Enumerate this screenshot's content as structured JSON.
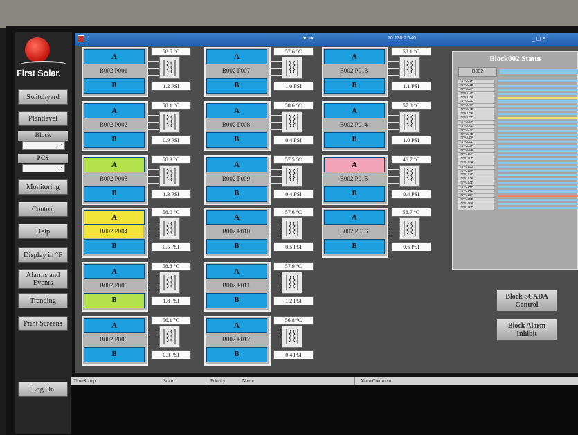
{
  "app": {
    "brand": "First Solar.",
    "window_ip": "10.130.2.140",
    "window_controls": "_ ◻ ×"
  },
  "sidebar": {
    "items": [
      {
        "label": "Switchyard"
      },
      {
        "label": "Plantlevel"
      },
      {
        "label": "Block"
      },
      {
        "label": "PCS"
      },
      {
        "label": "Monitoring"
      },
      {
        "label": "Control"
      },
      {
        "label": "Help"
      },
      {
        "label": "Display in °F"
      },
      {
        "label": "Alarms and Events"
      },
      {
        "label": "Trending"
      },
      {
        "label": "Print Screens"
      }
    ],
    "logon": "Log On"
  },
  "inverters": [
    {
      "name": "B002 P001",
      "a": "A",
      "b": "B",
      "temp": "58.5 °C",
      "psi": "1.2 PSI"
    },
    {
      "name": "B002 P002",
      "a": "A",
      "b": "B",
      "temp": "58.1 °C",
      "psi": "0.9 PSI"
    },
    {
      "name": "B002 P003",
      "a": "A",
      "b": "B",
      "temp": "58.3 °C",
      "psi": "1.3 PSI"
    },
    {
      "name": "B002 P004",
      "a": "A",
      "b": "B",
      "temp": "58.0 °C",
      "psi": "0.5 PSI"
    },
    {
      "name": "B002 P005",
      "a": "A",
      "b": "B",
      "temp": "58.8 °C",
      "psi": "1.8 PSI"
    },
    {
      "name": "B002 P006",
      "a": "A",
      "b": "B",
      "temp": "56.1 °C",
      "psi": "0.3 PSI"
    },
    {
      "name": "B002 P007",
      "a": "A",
      "b": "B",
      "temp": "57.6 °C",
      "psi": "1.0 PSI"
    },
    {
      "name": "B002 P008",
      "a": "A",
      "b": "B",
      "temp": "58.6 °C",
      "psi": "0.4 PSI"
    },
    {
      "name": "B002 P009",
      "a": "A",
      "b": "B",
      "temp": "57.5 °C",
      "psi": "0.4 PSI"
    },
    {
      "name": "B002 P010",
      "a": "A",
      "b": "B",
      "temp": "57.6 °C",
      "psi": "0.5 PSI"
    },
    {
      "name": "B002 P011",
      "a": "A",
      "b": "B",
      "temp": "57.9 °C",
      "psi": "1.2 PSI"
    },
    {
      "name": "B002 P012",
      "a": "A",
      "b": "B",
      "temp": "56.8 °C",
      "psi": "0.4 PSI"
    },
    {
      "name": "B002 P013",
      "a": "A",
      "b": "B",
      "temp": "58.1 °C",
      "psi": "1.1 PSI"
    },
    {
      "name": "B002 P014",
      "a": "A",
      "b": "B",
      "temp": "57.8 °C",
      "psi": "1.0 PSI"
    },
    {
      "name": "B002 P015",
      "a": "A",
      "b": "B",
      "temp": "46.7 °C",
      "psi": "0.4 PSI"
    },
    {
      "name": "B002 P016",
      "a": "A",
      "b": "B",
      "temp": "58.7 °C",
      "psi": "0.6 PSI"
    }
  ],
  "status": {
    "title": "Block002 Status",
    "block_label": "B002",
    "rows": [
      {
        "label": "INV001A",
        "color": "#8fc7e8"
      },
      {
        "label": "INV001B",
        "color": "#8fc7e8"
      },
      {
        "label": "INV002A",
        "color": "#8fc7e8"
      },
      {
        "label": "INV002B",
        "color": "#8fc7e8"
      },
      {
        "label": "INV003A",
        "color": "#e8e070"
      },
      {
        "label": "INV003B",
        "color": "#8fc7e8"
      },
      {
        "label": "INV004A",
        "color": "#8fc7e8"
      },
      {
        "label": "INV004B",
        "color": "#8fc7e8"
      },
      {
        "label": "INV005A",
        "color": "#8fc7e8"
      },
      {
        "label": "INV005B",
        "color": "#e8e070"
      },
      {
        "label": "INV006A",
        "color": "#8fc7e8"
      },
      {
        "label": "INV006B",
        "color": "#8fc7e8"
      },
      {
        "label": "INV007A",
        "color": "#8fc7e8"
      },
      {
        "label": "INV007B",
        "color": "#8fc7e8"
      },
      {
        "label": "INV008A",
        "color": "#8fc7e8"
      },
      {
        "label": "INV008B",
        "color": "#8fc7e8"
      },
      {
        "label": "INV009A",
        "color": "#8fc7e8"
      },
      {
        "label": "INV009B",
        "color": "#8fc7e8"
      },
      {
        "label": "INV010A",
        "color": "#8fc7e8"
      },
      {
        "label": "INV010B",
        "color": "#8fc7e8"
      },
      {
        "label": "INV011A",
        "color": "#8fc7e8"
      },
      {
        "label": "INV011B",
        "color": "#8fc7e8"
      },
      {
        "label": "INV012A",
        "color": "#8fc7e8"
      },
      {
        "label": "INV012B",
        "color": "#8fc7e8"
      },
      {
        "label": "INV013A",
        "color": "#8fc7e8"
      },
      {
        "label": "INV013B",
        "color": "#8fc7e8"
      },
      {
        "label": "INV014A",
        "color": "#8fc7e8"
      },
      {
        "label": "INV014B",
        "color": "#8fc7e8"
      },
      {
        "label": "INV015A",
        "color": "#e8806a"
      },
      {
        "label": "INV015B",
        "color": "#8fc7e8"
      },
      {
        "label": "INV016A",
        "color": "#8fc7e8"
      },
      {
        "label": "INV016B",
        "color": "#8fc7e8"
      }
    ]
  },
  "actions": {
    "scada": "Block SCADA Control",
    "inhibit": "Block Alarm Inhibit"
  },
  "alarms": {
    "columns": [
      "TimeStamp",
      "State",
      "Priority",
      "Name",
      "AlarmComment"
    ]
  },
  "colors": {
    "normal": "#1ea0e0",
    "warning_green": "#b4e24a",
    "warning_yellow": "#f2e53a",
    "fault_pink": "#f3a3b8"
  }
}
